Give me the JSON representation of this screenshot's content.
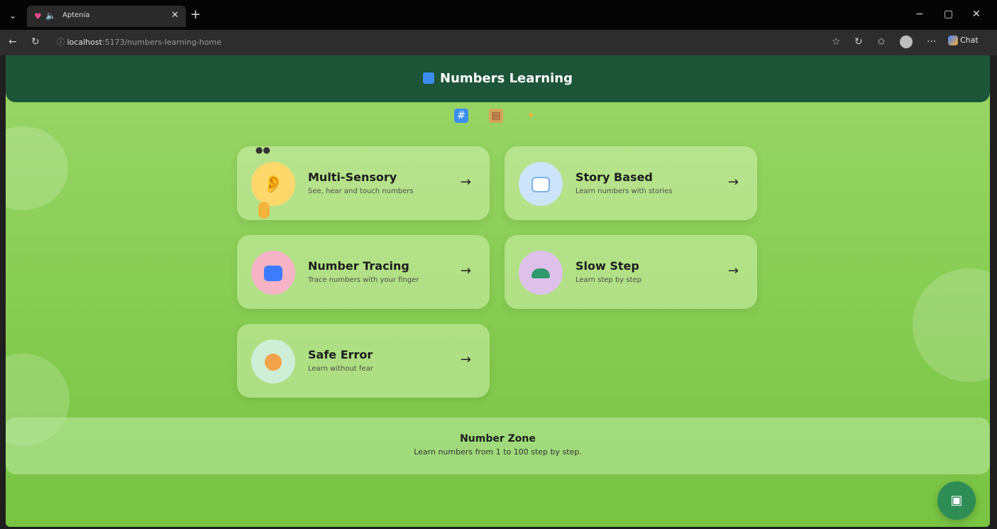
{
  "browser": {
    "tab_title": "Aptenia",
    "url_host": "localhost",
    "url_path": ":5173/numbers-learning-home",
    "chat_label": "Chat"
  },
  "header": {
    "title": "Numbers Learning"
  },
  "cards": [
    {
      "title": "Multi-Sensory",
      "subtitle": "See, hear and touch numbers",
      "icon": "ear-icon"
    },
    {
      "title": "Story Based",
      "subtitle": "Learn numbers with stories",
      "icon": "book-icon"
    },
    {
      "title": "Number Tracing",
      "subtitle": "Trace numbers with your finger",
      "icon": "trace-icon"
    },
    {
      "title": "Slow Step",
      "subtitle": "Learn step by step",
      "icon": "turtle-icon"
    },
    {
      "title": "Safe Error",
      "subtitle": "Learn without fear",
      "icon": "smile-icon"
    }
  ],
  "zone": {
    "title": "Number Zone",
    "subtitle": "Learn numbers from 1 to 100 step by step."
  },
  "colors": {
    "header_bg": "#1d5538",
    "page_bg": "#86cc52",
    "fab_bg": "#2e8c55"
  }
}
